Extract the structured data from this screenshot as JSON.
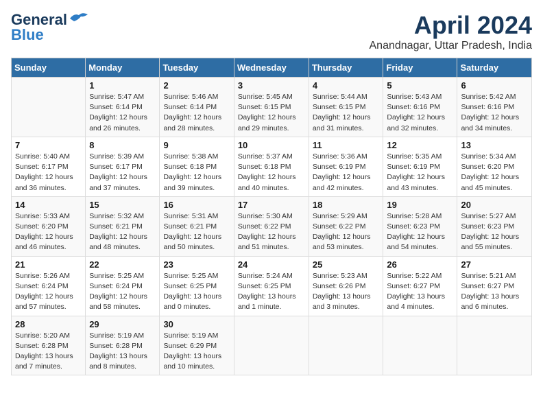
{
  "header": {
    "logo_general": "General",
    "logo_blue": "Blue",
    "month": "April 2024",
    "location": "Anandnagar, Uttar Pradesh, India"
  },
  "weekdays": [
    "Sunday",
    "Monday",
    "Tuesday",
    "Wednesday",
    "Thursday",
    "Friday",
    "Saturday"
  ],
  "weeks": [
    [
      {
        "day": "",
        "info": ""
      },
      {
        "day": "1",
        "info": "Sunrise: 5:47 AM\nSunset: 6:14 PM\nDaylight: 12 hours\nand 26 minutes."
      },
      {
        "day": "2",
        "info": "Sunrise: 5:46 AM\nSunset: 6:14 PM\nDaylight: 12 hours\nand 28 minutes."
      },
      {
        "day": "3",
        "info": "Sunrise: 5:45 AM\nSunset: 6:15 PM\nDaylight: 12 hours\nand 29 minutes."
      },
      {
        "day": "4",
        "info": "Sunrise: 5:44 AM\nSunset: 6:15 PM\nDaylight: 12 hours\nand 31 minutes."
      },
      {
        "day": "5",
        "info": "Sunrise: 5:43 AM\nSunset: 6:16 PM\nDaylight: 12 hours\nand 32 minutes."
      },
      {
        "day": "6",
        "info": "Sunrise: 5:42 AM\nSunset: 6:16 PM\nDaylight: 12 hours\nand 34 minutes."
      }
    ],
    [
      {
        "day": "7",
        "info": "Sunrise: 5:40 AM\nSunset: 6:17 PM\nDaylight: 12 hours\nand 36 minutes."
      },
      {
        "day": "8",
        "info": "Sunrise: 5:39 AM\nSunset: 6:17 PM\nDaylight: 12 hours\nand 37 minutes."
      },
      {
        "day": "9",
        "info": "Sunrise: 5:38 AM\nSunset: 6:18 PM\nDaylight: 12 hours\nand 39 minutes."
      },
      {
        "day": "10",
        "info": "Sunrise: 5:37 AM\nSunset: 6:18 PM\nDaylight: 12 hours\nand 40 minutes."
      },
      {
        "day": "11",
        "info": "Sunrise: 5:36 AM\nSunset: 6:19 PM\nDaylight: 12 hours\nand 42 minutes."
      },
      {
        "day": "12",
        "info": "Sunrise: 5:35 AM\nSunset: 6:19 PM\nDaylight: 12 hours\nand 43 minutes."
      },
      {
        "day": "13",
        "info": "Sunrise: 5:34 AM\nSunset: 6:20 PM\nDaylight: 12 hours\nand 45 minutes."
      }
    ],
    [
      {
        "day": "14",
        "info": "Sunrise: 5:33 AM\nSunset: 6:20 PM\nDaylight: 12 hours\nand 46 minutes."
      },
      {
        "day": "15",
        "info": "Sunrise: 5:32 AM\nSunset: 6:21 PM\nDaylight: 12 hours\nand 48 minutes."
      },
      {
        "day": "16",
        "info": "Sunrise: 5:31 AM\nSunset: 6:21 PM\nDaylight: 12 hours\nand 50 minutes."
      },
      {
        "day": "17",
        "info": "Sunrise: 5:30 AM\nSunset: 6:22 PM\nDaylight: 12 hours\nand 51 minutes."
      },
      {
        "day": "18",
        "info": "Sunrise: 5:29 AM\nSunset: 6:22 PM\nDaylight: 12 hours\nand 53 minutes."
      },
      {
        "day": "19",
        "info": "Sunrise: 5:28 AM\nSunset: 6:23 PM\nDaylight: 12 hours\nand 54 minutes."
      },
      {
        "day": "20",
        "info": "Sunrise: 5:27 AM\nSunset: 6:23 PM\nDaylight: 12 hours\nand 55 minutes."
      }
    ],
    [
      {
        "day": "21",
        "info": "Sunrise: 5:26 AM\nSunset: 6:24 PM\nDaylight: 12 hours\nand 57 minutes."
      },
      {
        "day": "22",
        "info": "Sunrise: 5:25 AM\nSunset: 6:24 PM\nDaylight: 12 hours\nand 58 minutes."
      },
      {
        "day": "23",
        "info": "Sunrise: 5:25 AM\nSunset: 6:25 PM\nDaylight: 13 hours\nand 0 minutes."
      },
      {
        "day": "24",
        "info": "Sunrise: 5:24 AM\nSunset: 6:25 PM\nDaylight: 13 hours\nand 1 minute."
      },
      {
        "day": "25",
        "info": "Sunrise: 5:23 AM\nSunset: 6:26 PM\nDaylight: 13 hours\nand 3 minutes."
      },
      {
        "day": "26",
        "info": "Sunrise: 5:22 AM\nSunset: 6:27 PM\nDaylight: 13 hours\nand 4 minutes."
      },
      {
        "day": "27",
        "info": "Sunrise: 5:21 AM\nSunset: 6:27 PM\nDaylight: 13 hours\nand 6 minutes."
      }
    ],
    [
      {
        "day": "28",
        "info": "Sunrise: 5:20 AM\nSunset: 6:28 PM\nDaylight: 13 hours\nand 7 minutes."
      },
      {
        "day": "29",
        "info": "Sunrise: 5:19 AM\nSunset: 6:28 PM\nDaylight: 13 hours\nand 8 minutes."
      },
      {
        "day": "30",
        "info": "Sunrise: 5:19 AM\nSunset: 6:29 PM\nDaylight: 13 hours\nand 10 minutes."
      },
      {
        "day": "",
        "info": ""
      },
      {
        "day": "",
        "info": ""
      },
      {
        "day": "",
        "info": ""
      },
      {
        "day": "",
        "info": ""
      }
    ]
  ]
}
